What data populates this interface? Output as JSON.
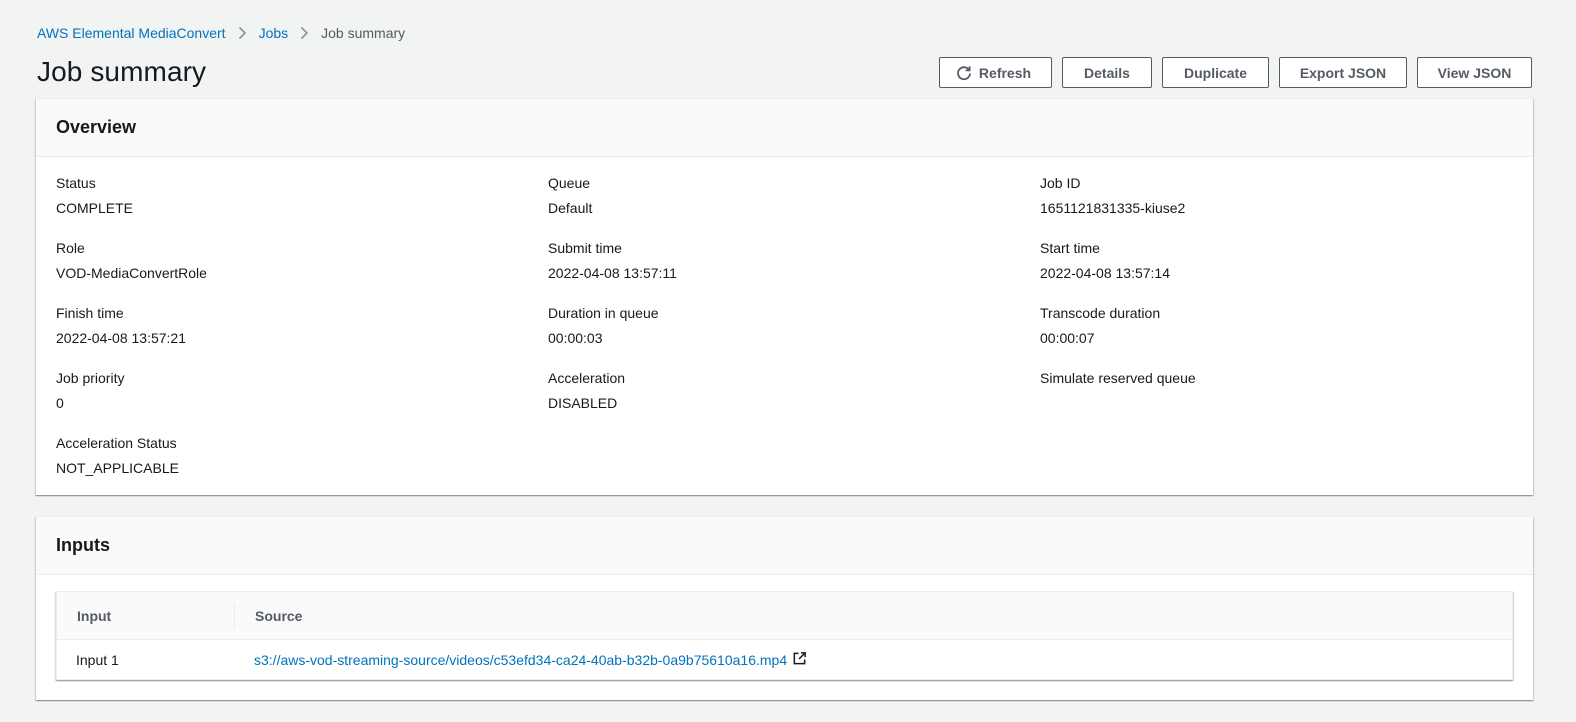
{
  "breadcrumb": {
    "items": [
      {
        "label": "AWS Elemental MediaConvert",
        "link": true
      },
      {
        "label": "Jobs",
        "link": true
      },
      {
        "label": "Job summary",
        "link": false
      }
    ]
  },
  "page_title": "Job summary",
  "actions": {
    "refresh": "Refresh",
    "details": "Details",
    "duplicate": "Duplicate",
    "export_json": "Export JSON",
    "view_json": "View JSON"
  },
  "overview": {
    "title": "Overview",
    "fields": {
      "status": {
        "label": "Status",
        "value": "COMPLETE"
      },
      "queue": {
        "label": "Queue",
        "value": "Default"
      },
      "job_id": {
        "label": "Job ID",
        "value": "1651121831335-kiuse2"
      },
      "role": {
        "label": "Role",
        "value": "VOD-MediaConvertRole"
      },
      "submit_time": {
        "label": "Submit time",
        "value": "2022-04-08 13:57:11"
      },
      "start_time": {
        "label": "Start time",
        "value": "2022-04-08 13:57:14"
      },
      "finish_time": {
        "label": "Finish time",
        "value": "2022-04-08 13:57:21"
      },
      "duration_in_queue": {
        "label": "Duration in queue",
        "value": "00:00:03"
      },
      "transcode_duration": {
        "label": "Transcode duration",
        "value": "00:00:07"
      },
      "job_priority": {
        "label": "Job priority",
        "value": "0"
      },
      "acceleration": {
        "label": "Acceleration",
        "value": "DISABLED"
      },
      "simulate_reserved_queue": {
        "label": "Simulate reserved queue",
        "value": ""
      },
      "acceleration_status": {
        "label": "Acceleration Status",
        "value": "NOT_APPLICABLE"
      }
    }
  },
  "inputs": {
    "title": "Inputs",
    "columns": {
      "input": "Input",
      "source": "Source"
    },
    "rows": [
      {
        "input": "Input 1",
        "source": "s3://aws-vod-streaming-source/videos/c53efd34-ca24-40ab-b32b-0a9b75610a16.mp4"
      }
    ]
  },
  "colors": {
    "link": "#0073bb",
    "background": "#f2f3f3",
    "button_text": "#545b64"
  }
}
